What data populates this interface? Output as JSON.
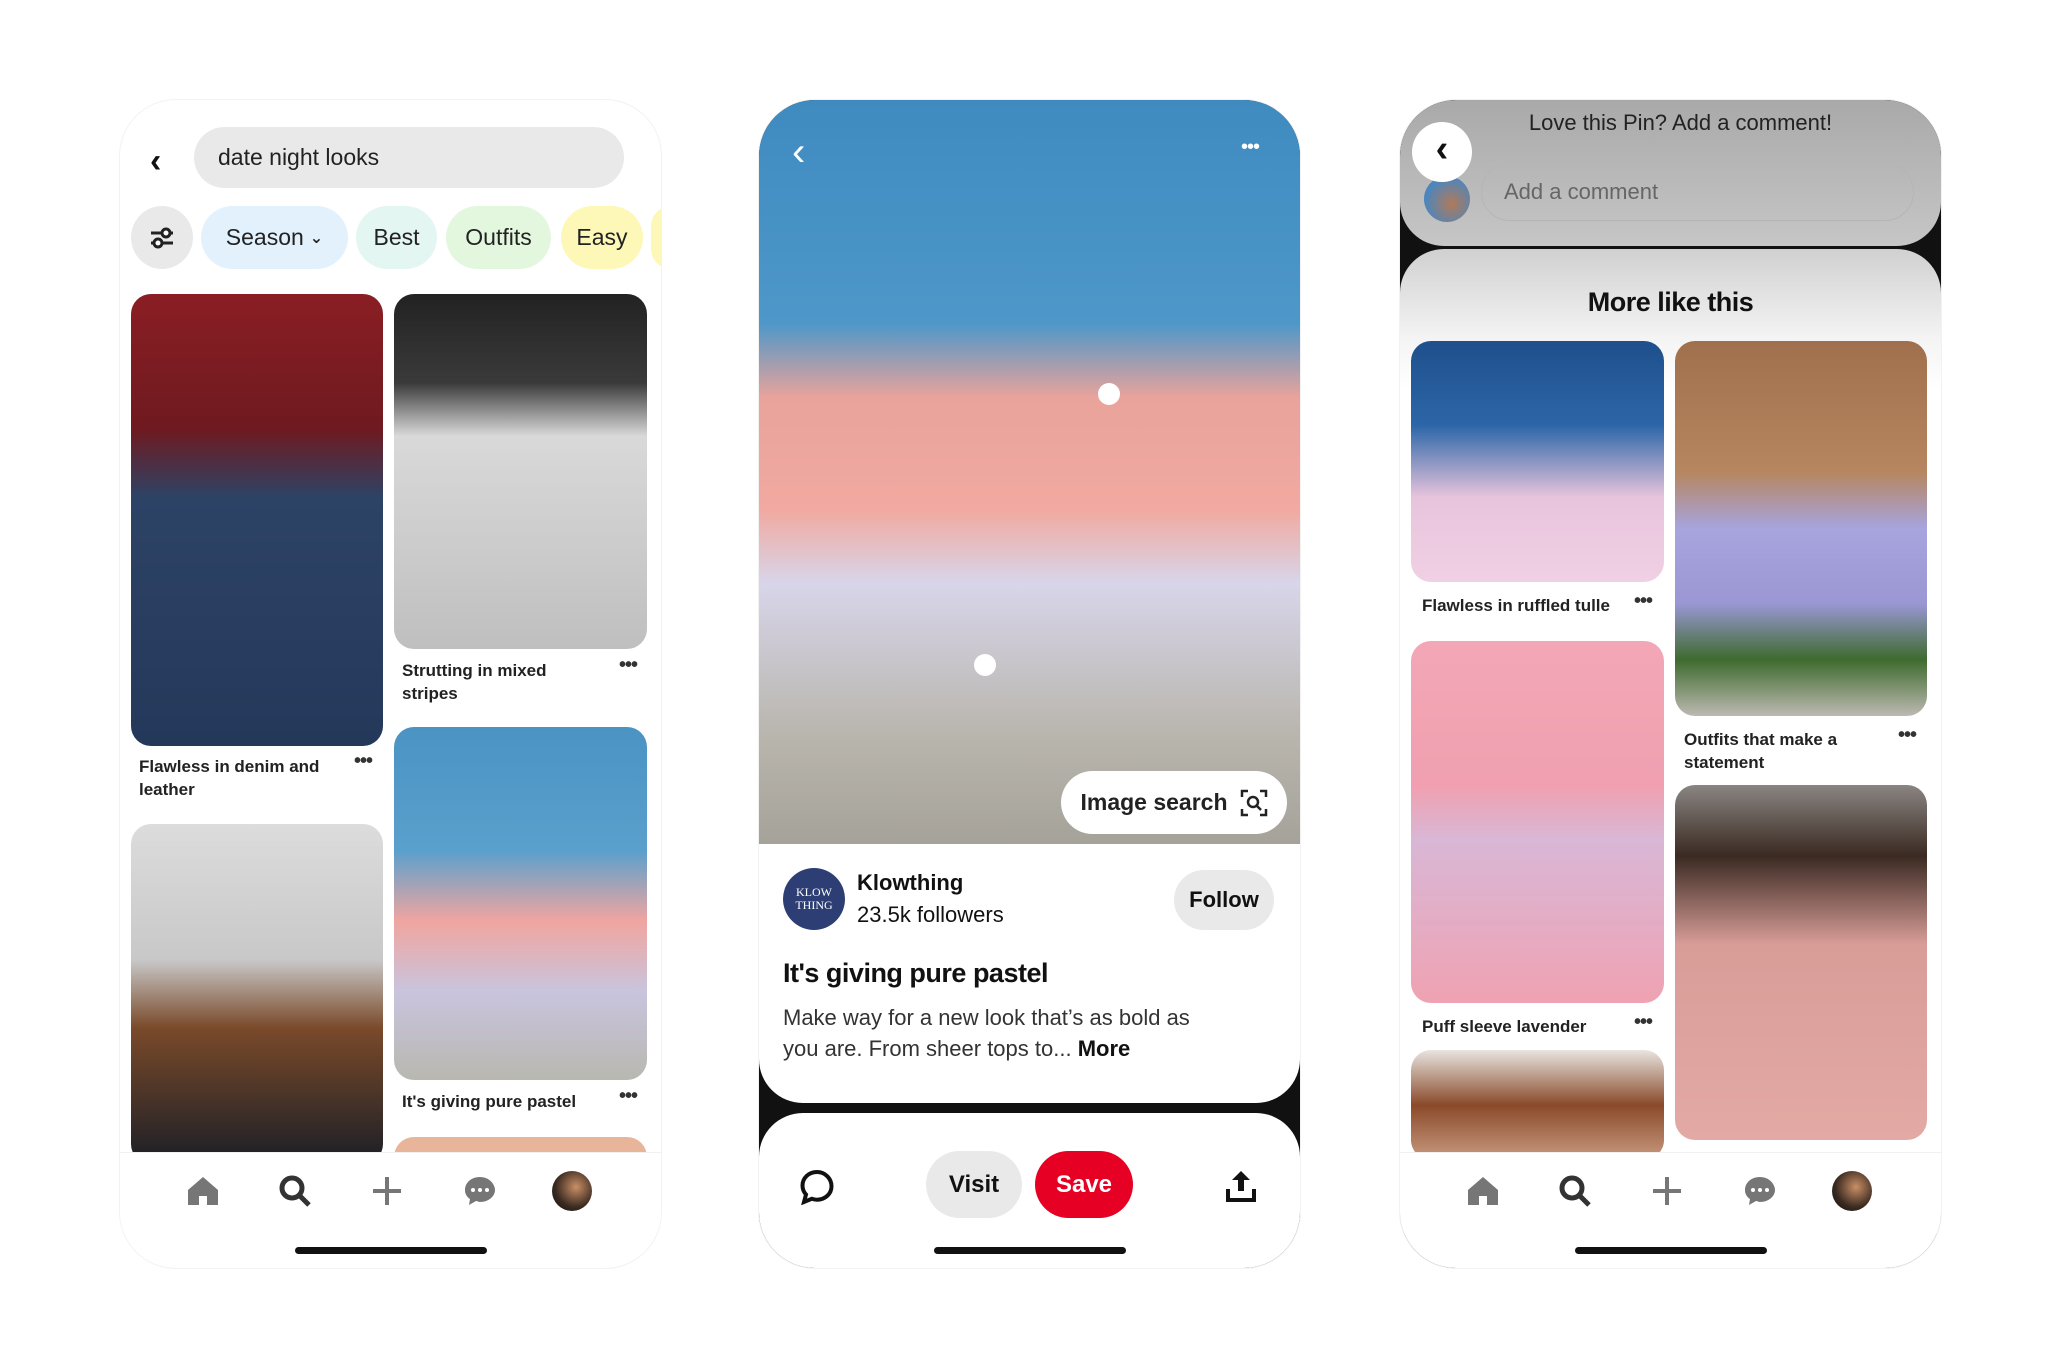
{
  "colors": {
    "save_red": "#e60023",
    "chip_season": "#e2f1fc",
    "chip_best": "#e3f6f1",
    "chip_outfits": "#e3f7df",
    "chip_easy": "#fdf8b8",
    "avatar_brand": "#2c3e73"
  },
  "search_screen": {
    "query": "date night looks",
    "chips": [
      {
        "label": "Season",
        "has_dropdown": true
      },
      {
        "label": "Best"
      },
      {
        "label": "Outfits"
      },
      {
        "label": "Easy"
      }
    ],
    "pins": [
      {
        "caption": "Flawless in denim and leather"
      },
      {
        "caption": "Strutting in mixed stripes"
      },
      {
        "caption": "It's giving pure pastel"
      },
      {
        "caption": ""
      }
    ],
    "nav_icons": [
      "home-icon",
      "search-icon",
      "plus-icon",
      "chat-icon",
      "profile-avatar"
    ]
  },
  "pin_screen": {
    "image_search_label": "Image search",
    "author": {
      "avatar_text": "KLOW THING",
      "name": "Klowthing",
      "followers": "23.5k followers"
    },
    "follow_label": "Follow",
    "title": "It's giving pure pastel",
    "description": "Make way for a new look that’s as bold as you are. From sheer tops to...",
    "more_label": "More",
    "visit_label": "Visit",
    "save_label": "Save"
  },
  "comments_screen": {
    "prompt": "Love this Pin? Add a comment!",
    "comment_placeholder": "Add a comment",
    "section_title": "More like this",
    "pins": [
      {
        "caption": "Flawless in ruffled tulle"
      },
      {
        "caption": "Outfits that make a statement"
      },
      {
        "caption": "Puff sleeve lavender"
      },
      {
        "caption": ""
      },
      {
        "caption": ""
      }
    ]
  }
}
